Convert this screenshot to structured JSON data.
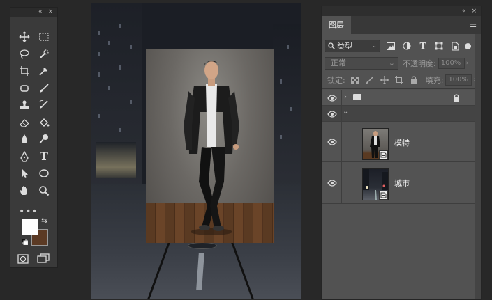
{
  "tools": {
    "panel_controls": [
      "«",
      "×"
    ],
    "items": [
      "move-tool",
      "marquee-tool",
      "lasso-tool",
      "quick-select-tool",
      "crop-tool",
      "eyedropper-tool",
      "frame-tool",
      "brush-tool",
      "stamp-tool",
      "history-brush-tool",
      "eraser-tool",
      "paint-bucket-tool",
      "blur-tool",
      "dodge-tool",
      "pen-tool",
      "type-tool",
      "path-select-tool",
      "ellipse-tool",
      "hand-tool",
      "zoom-tool"
    ],
    "type_tool_glyph": "T",
    "more": "•••",
    "foreground_color": "#ffffff",
    "background_color": "#5b3a24"
  },
  "canvas": {
    "document": "city-background-with-model"
  },
  "layers_panel": {
    "panel_controls": [
      "«",
      "×"
    ],
    "tab_label": "图层",
    "menu_glyph": "☰",
    "filter": {
      "kind_label": "类型",
      "icons": [
        "image-filter-icon",
        "adjustment-filter-icon",
        "type-filter-icon",
        "shape-filter-icon",
        "smart-object-filter-icon"
      ],
      "type_glyph": "T"
    },
    "blend_mode": "正常",
    "opacity_label": "不透明度:",
    "opacity_value": "100%",
    "lock_label": "锁定:",
    "fill_label": "填充:",
    "fill_value": "100%",
    "layers": [
      {
        "kind": "group",
        "collapsed": true,
        "locked": true,
        "visible": true
      },
      {
        "kind": "group",
        "collapsed": false,
        "visible": true
      },
      {
        "kind": "smart-object",
        "name": "模特",
        "visible": true
      },
      {
        "kind": "smart-object",
        "name": "城市",
        "visible": true
      }
    ]
  }
}
